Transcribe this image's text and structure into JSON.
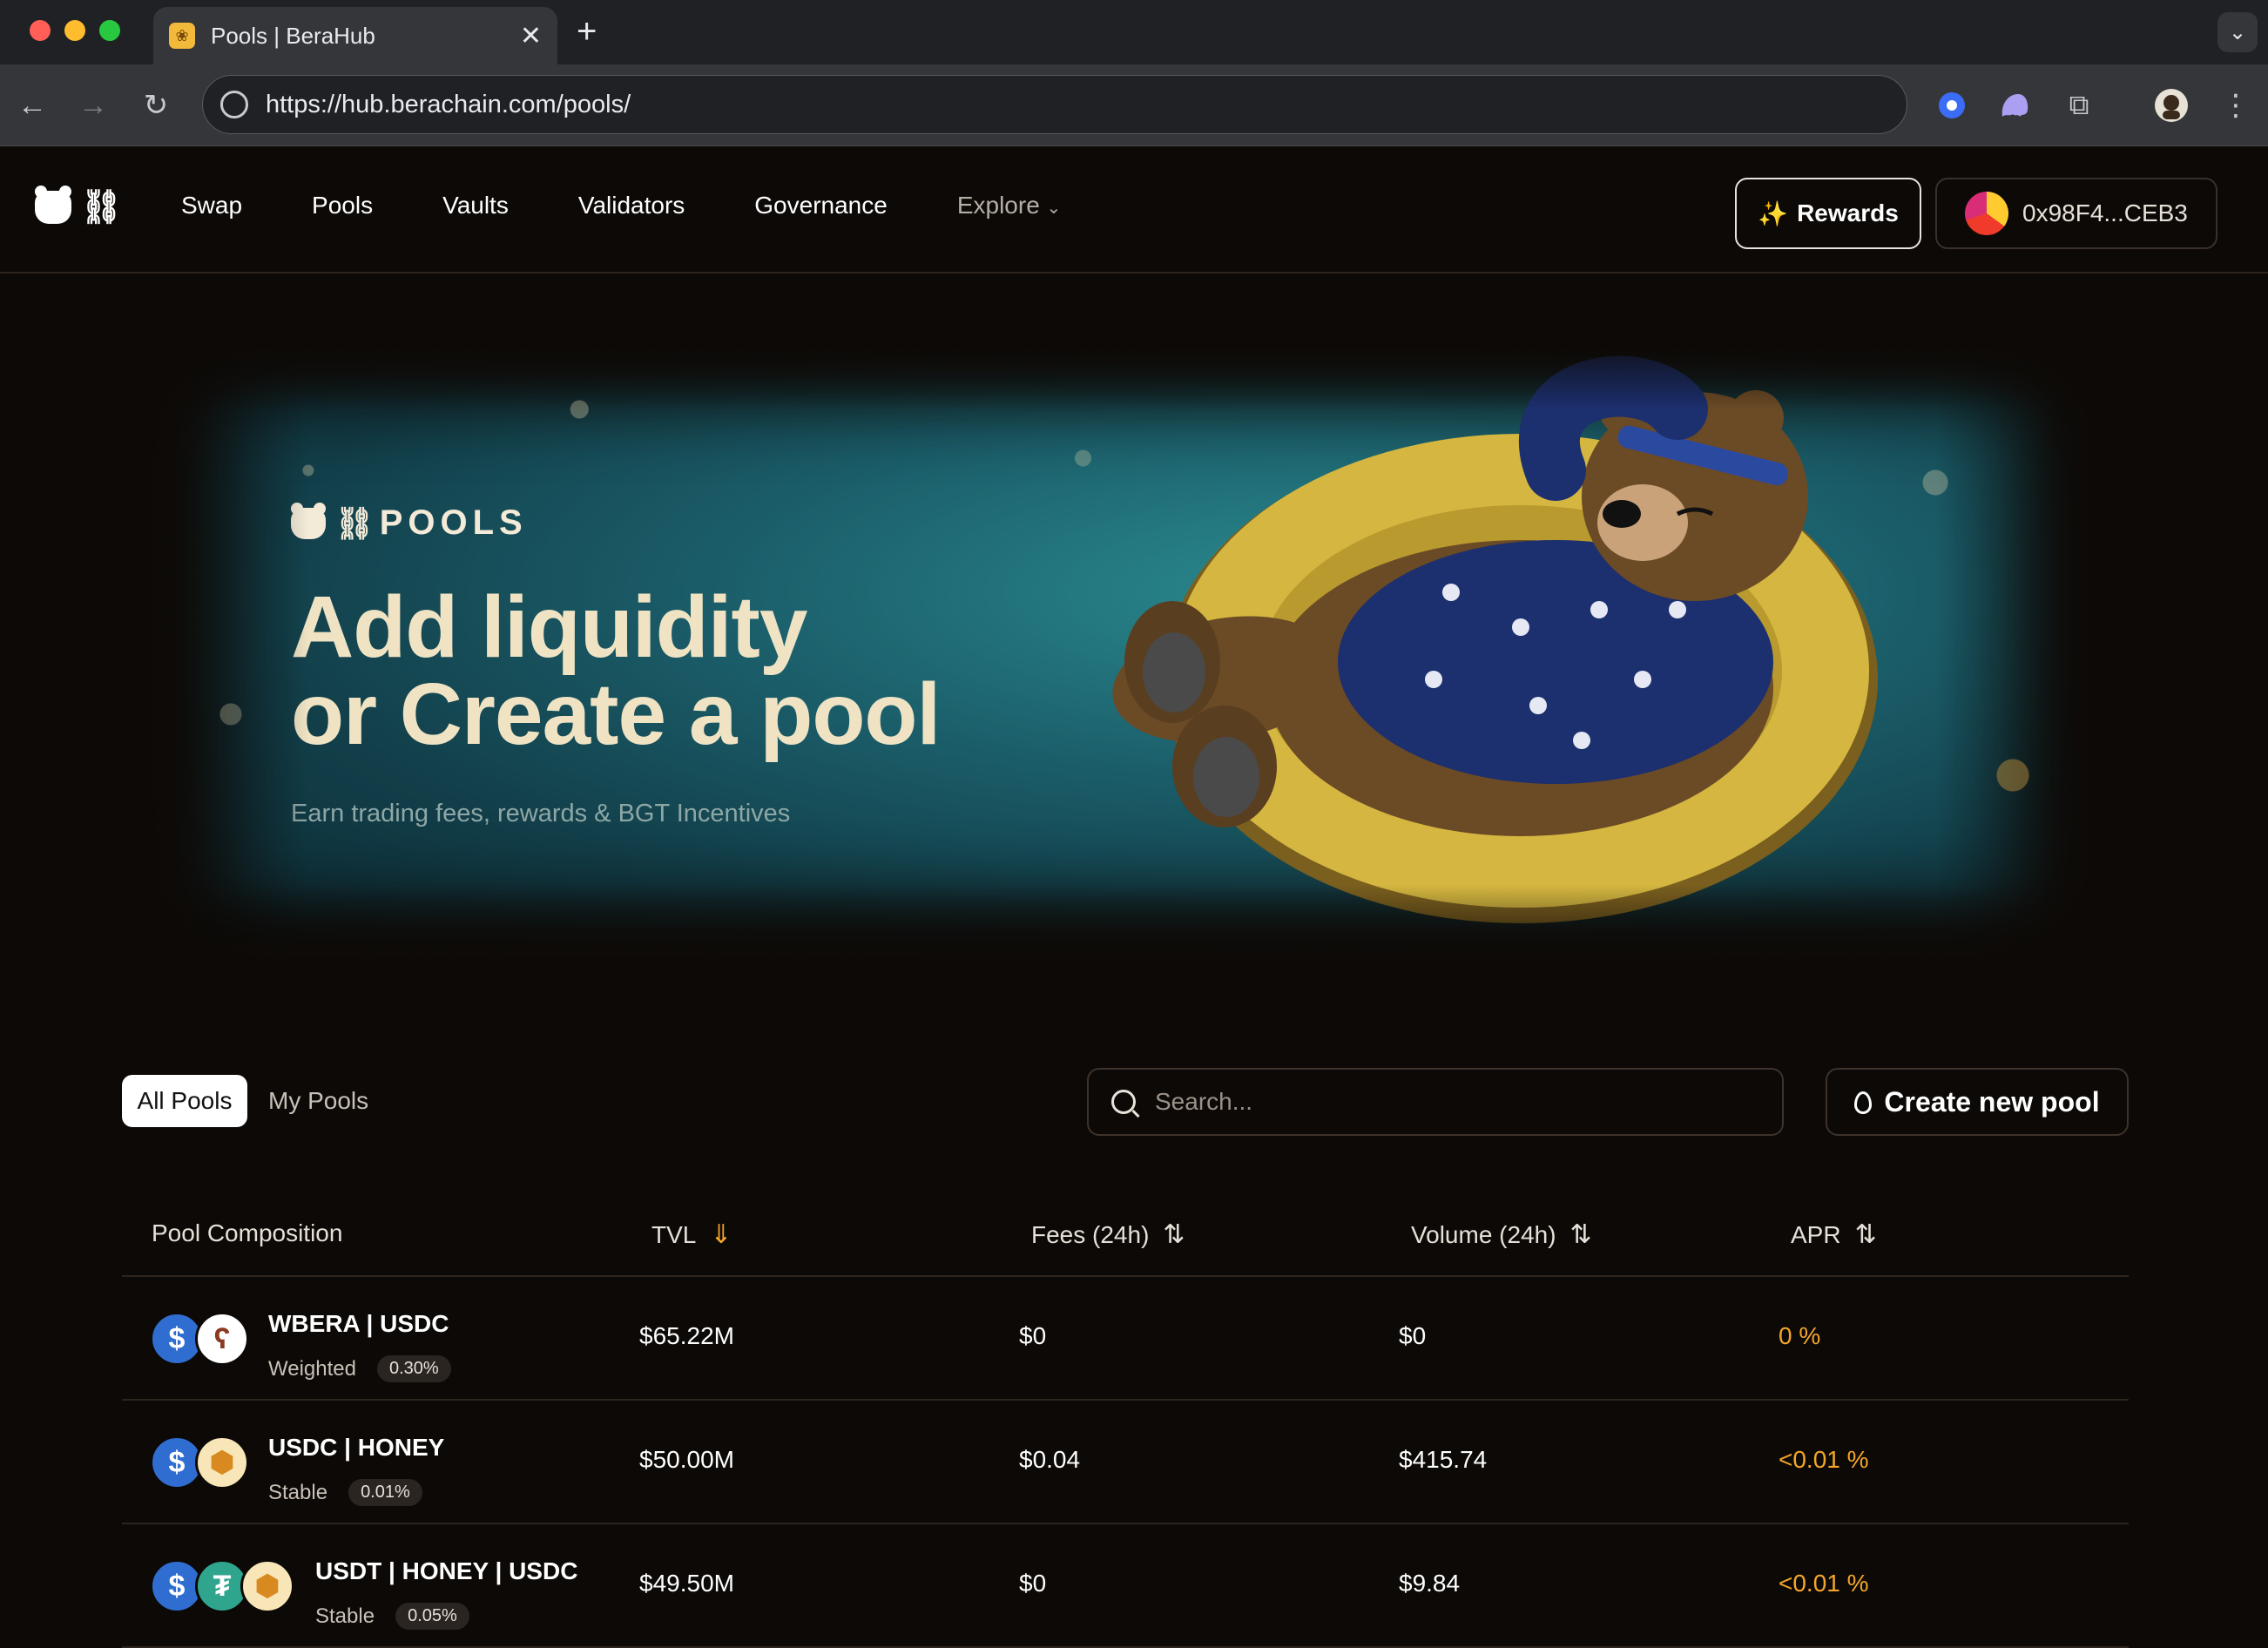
{
  "browser": {
    "tab_title": "Pools | BeraHub",
    "url": "https://hub.berachain.com/pools/"
  },
  "nav": {
    "links": [
      "Swap",
      "Pools",
      "Vaults",
      "Validators",
      "Governance",
      "Explore"
    ],
    "rewards_label": "Rewards",
    "wallet_address": "0x98F4...CEB3"
  },
  "hero": {
    "brand": "POOLS",
    "title_line1": "Add liquidity",
    "title_line2": "or Create a pool",
    "subtitle": "Earn trading fees, rewards & BGT Incentives"
  },
  "filters": {
    "all_pools": "All Pools",
    "my_pools": "My Pools",
    "search_placeholder": "Search...",
    "create_label": "Create new pool"
  },
  "table": {
    "headers": [
      "Pool Composition",
      "TVL",
      "Fees (24h)",
      "Volume (24h)",
      "APR"
    ],
    "rows": [
      {
        "name": "WBERA | USDC",
        "type": "Weighted",
        "fee": "0.30%",
        "tvl": "$65.22M",
        "fees": "$0",
        "volume": "$0",
        "apr": "0 %",
        "tokens": [
          "usdc",
          "wbera"
        ]
      },
      {
        "name": "USDC | HONEY",
        "type": "Stable",
        "fee": "0.01%",
        "tvl": "$50.00M",
        "fees": "$0.04",
        "volume": "$415.74",
        "apr": "<0.01 %",
        "tokens": [
          "usdc",
          "honey"
        ]
      },
      {
        "name": "USDT | HONEY | USDC",
        "type": "Stable",
        "fee": "0.05%",
        "tvl": "$49.50M",
        "fees": "$0",
        "volume": "$9.84",
        "apr": "<0.01 %",
        "tokens": [
          "usdc",
          "usdt",
          "honey"
        ]
      }
    ]
  },
  "colors": {
    "accent": "#f4a62a",
    "background": "#0d0906",
    "hero_text": "#efe3c4"
  }
}
